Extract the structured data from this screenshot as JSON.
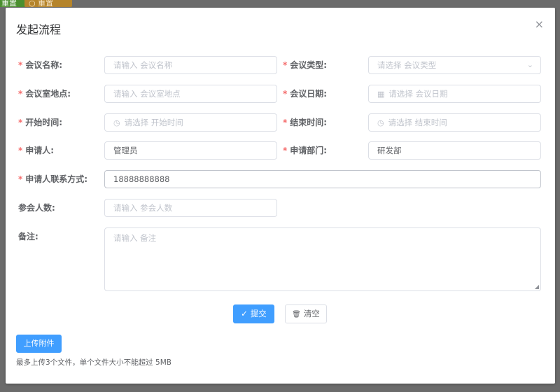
{
  "background": {
    "btn1": "重置",
    "btn2": "○ 重置"
  },
  "dialog": {
    "title": "发起流程",
    "close": "×"
  },
  "form": {
    "meeting_name": {
      "label": "会议名称:",
      "placeholder": "请输入 会议名称",
      "required": true
    },
    "meeting_type": {
      "label": "会议类型:",
      "placeholder": "请选择 会议类型",
      "required": true
    },
    "meeting_location": {
      "label": "会议室地点:",
      "placeholder": "请输入 会议室地点",
      "required": true
    },
    "meeting_date": {
      "label": "会议日期:",
      "placeholder": "请选择 会议日期",
      "required": true
    },
    "start_time": {
      "label": "开始时间:",
      "placeholder": "请选择 开始时间",
      "required": true
    },
    "end_time": {
      "label": "结束时间:",
      "placeholder": "请选择 结束时间",
      "required": true
    },
    "applicant": {
      "label": "申请人:",
      "value": "管理员",
      "required": true
    },
    "department": {
      "label": "申请部门:",
      "value": "研发部",
      "required": true
    },
    "contact": {
      "label": "申请人联系方式:",
      "value": "18888888888",
      "required": true
    },
    "attendees": {
      "label": "参会人数:",
      "placeholder": "请输入 参会人数"
    },
    "remarks": {
      "label": "备注:",
      "placeholder": "请输入 备注"
    }
  },
  "buttons": {
    "submit": "提交",
    "clear": "清空",
    "upload": "上传附件"
  },
  "upload_hint": "最多上传3个文件，单个文件大小不能超过 5MB",
  "icons": {
    "required_mark": "*",
    "check": "✓",
    "trash": "🗑",
    "clock": "◷",
    "calendar": "▦",
    "chevron": "⌄"
  },
  "colors": {
    "primary": "#409eff",
    "required": "#f56c6c",
    "border": "#dcdfe6"
  }
}
